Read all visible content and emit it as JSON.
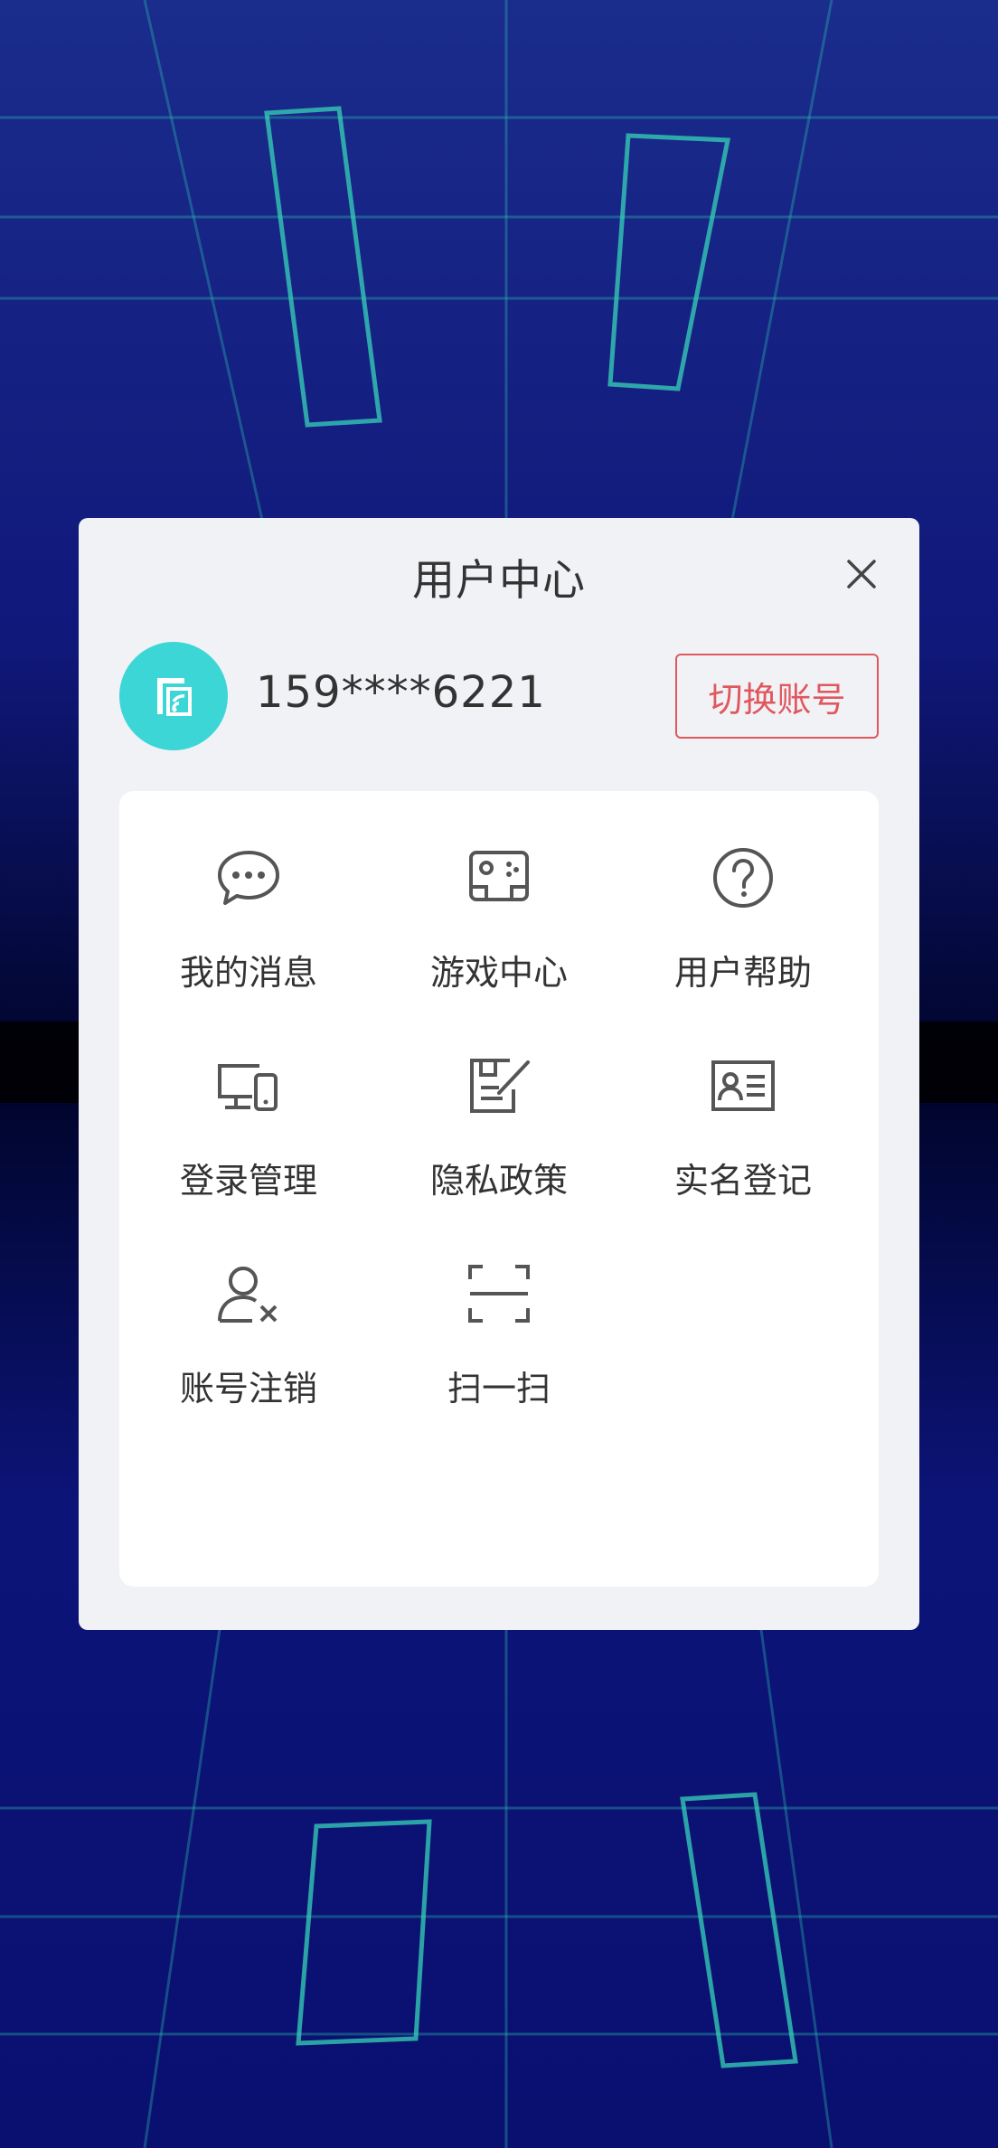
{
  "dialog": {
    "title": "用户中心",
    "account": {
      "phone": "159****6221",
      "switch_label": "切换账号"
    },
    "menu": [
      {
        "label": "我的消息",
        "icon": "chat-bubble-icon"
      },
      {
        "label": "游戏中心",
        "icon": "gamepad-icon"
      },
      {
        "label": "用户帮助",
        "icon": "help-circle-icon"
      },
      {
        "label": "登录管理",
        "icon": "devices-icon"
      },
      {
        "label": "隐私政策",
        "icon": "document-edit-icon"
      },
      {
        "label": "实名登记",
        "icon": "id-card-icon"
      },
      {
        "label": "账号注销",
        "icon": "user-remove-icon"
      },
      {
        "label": "扫一扫",
        "icon": "scan-icon"
      }
    ]
  },
  "colors": {
    "accent": "#e0585e",
    "avatar_bg": "#3cd6d6",
    "dialog_bg": "#f1f2f6",
    "panel_bg": "#ffffff",
    "background": "#0a0f6a"
  }
}
